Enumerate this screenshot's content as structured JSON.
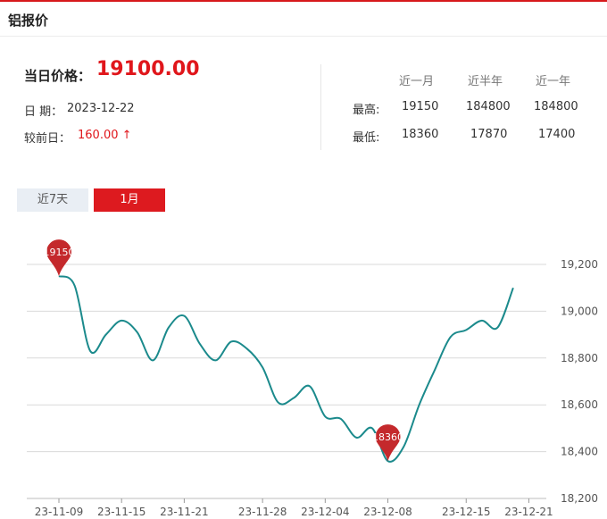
{
  "header": {
    "title": "铝报价"
  },
  "summary": {
    "price_label": "当日价格：",
    "price_value": "19100.00",
    "date_label": "日 期：",
    "date_value": "2023-12-22",
    "prev_label": "较前日：",
    "prev_value": "160.00 ↑"
  },
  "stats": {
    "columns": [
      "近一月",
      "近半年",
      "近一年"
    ],
    "rows": [
      {
        "label": "最高:",
        "values": [
          "19150",
          "184800",
          "184800"
        ]
      },
      {
        "label": "最低:",
        "values": [
          "18360",
          "17870",
          "17400"
        ]
      }
    ]
  },
  "tabs": {
    "week": "近7天",
    "month": "1月"
  },
  "colors": {
    "accent": "#dd1a1f",
    "line": "#1b8a8c",
    "marker": "#c4292c"
  },
  "chart_data": {
    "type": "line",
    "x": [
      "23-11-09",
      "23-11-10",
      "23-11-13",
      "23-11-14",
      "23-11-15",
      "23-11-16",
      "23-11-17",
      "23-11-20",
      "23-11-21",
      "23-11-22",
      "23-11-23",
      "23-11-24",
      "23-11-27",
      "23-11-28",
      "23-11-29",
      "23-11-30",
      "23-12-01",
      "23-12-04",
      "23-12-05",
      "23-12-06",
      "23-12-07",
      "23-12-08",
      "23-12-11",
      "23-12-12",
      "23-12-13",
      "23-12-14",
      "23-12-15",
      "23-12-18",
      "23-12-19",
      "23-12-20",
      "23-12-21",
      "23-12-22"
    ],
    "series": [
      {
        "values": [
          19150,
          19110,
          18830,
          18900,
          18960,
          18910,
          18790,
          18930,
          18980,
          18860,
          18790,
          18870,
          18840,
          18760,
          18610,
          18630,
          18680,
          18550,
          18540,
          18460,
          18500,
          18360,
          18420,
          18600,
          18750,
          18890,
          18920,
          18960,
          18930,
          19100
        ]
      }
    ],
    "xticks": [
      "23-11-09",
      "23-11-15",
      "23-11-21",
      "23-11-28",
      "23-12-04",
      "23-12-08",
      "23-12-15",
      "23-12-21"
    ],
    "yticks": [
      "18,200",
      "18,400",
      "18,600",
      "18,800",
      "19,000",
      "19,200"
    ],
    "ylim": [
      18200,
      19200
    ],
    "markers": [
      {
        "label": "19150"
      },
      {
        "label": "18360"
      }
    ],
    "grid": true,
    "legend": "none"
  }
}
